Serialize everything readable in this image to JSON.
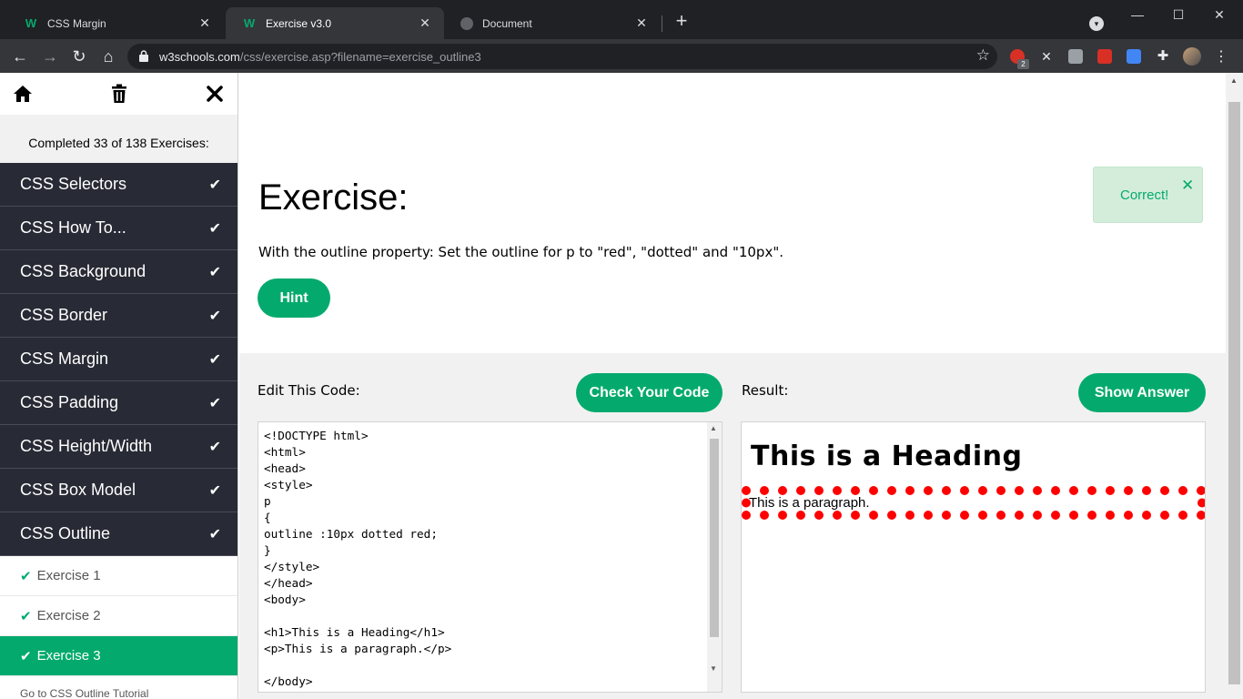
{
  "browser": {
    "tabs": [
      {
        "title": "CSS Margin",
        "active": false
      },
      {
        "title": "Exercise v3.0",
        "active": true
      },
      {
        "title": "Document",
        "active": false
      }
    ],
    "url_host": "w3schools.com",
    "url_path": "/css/exercise.asp?filename=exercise_outline3",
    "extension_badge": "2"
  },
  "sidebar": {
    "progress": "Completed 33 of 138 Exercises:",
    "chapters": [
      {
        "label": "CSS Selectors"
      },
      {
        "label": "CSS How To..."
      },
      {
        "label": "CSS Background"
      },
      {
        "label": "CSS Border"
      },
      {
        "label": "CSS Margin"
      },
      {
        "label": "CSS Padding"
      },
      {
        "label": "CSS Height/Width"
      },
      {
        "label": "CSS Box Model"
      },
      {
        "label": "CSS Outline"
      }
    ],
    "exercises": [
      {
        "label": "Exercise 1",
        "active": false
      },
      {
        "label": "Exercise 2",
        "active": false
      },
      {
        "label": "Exercise 3",
        "active": true
      }
    ],
    "tutorial_link": "Go to CSS Outline Tutorial"
  },
  "main": {
    "title": "Exercise:",
    "description": "With the outline property: Set the outline for p to \"red\", \"dotted\" and \"10px\".",
    "hint_button": "Hint",
    "toast_message": "Correct!",
    "edit_label": "Edit This Code:",
    "check_button": "Check Your Code",
    "result_label": "Result:",
    "show_answer_button": "Show Answer",
    "code": "<!DOCTYPE html>\n<html>\n<head>\n<style>\np\n{\noutline :10px dotted red;\n}\n</style>\n</head>\n<body>\n\n<h1>This is a Heading</h1>\n<p>This is a paragraph.</p>\n\n</body>",
    "result_heading": "This is a Heading",
    "result_paragraph": "This is a paragraph.",
    "colors": {
      "accent": "#04aa6d",
      "sidebar_dark": "#282a35",
      "outline": "#ff0000"
    }
  }
}
